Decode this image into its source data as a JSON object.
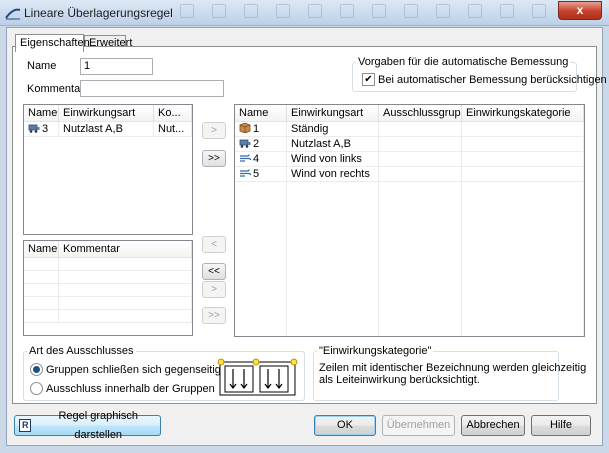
{
  "window": {
    "title": "Lineare Überlagerungsregel",
    "close_label": "x"
  },
  "tabs": [
    {
      "label": "Eigenschaften",
      "active": true
    },
    {
      "label": "Erweitert",
      "active": false
    }
  ],
  "form": {
    "name_label": "Name",
    "name_value": "1",
    "comment_label": "Kommentar",
    "comment_value": ""
  },
  "design_defaults": {
    "title": "Vorgaben für die automatische Bemessung",
    "checkbox_label": "Bei automatischer Bemessung berücksichtigen",
    "checked": true
  },
  "left_list": {
    "columns": [
      "Name",
      "Einwirkungsart",
      "Ko..."
    ],
    "rows": [
      {
        "name": "3",
        "type": "Nutzlast A,B",
        "ko": "Nut..."
      }
    ]
  },
  "group_list": {
    "columns": [
      "Name",
      "Kommentar"
    ]
  },
  "right_list": {
    "columns": [
      "Name",
      "Einwirkungsart",
      "Ausschlussgruppe",
      "Einwirkungskategorie"
    ],
    "rows": [
      {
        "name": "1",
        "type": "Ständig",
        "icon": "box-load-icon"
      },
      {
        "name": "2",
        "type": "Nutzlast A,B",
        "icon": "traffic-load-icon"
      },
      {
        "name": "4",
        "type": "Wind von links",
        "icon": "wind-load-icon"
      },
      {
        "name": "5",
        "type": "Wind von rechts",
        "icon": "wind-load-icon"
      }
    ]
  },
  "transfer_buttons": {
    "move_right": ">",
    "move_all_right": ">>",
    "move_left": "<",
    "move_all_left": "<<",
    "group_right": ">",
    "group_all_right": ">>"
  },
  "exclusion": {
    "title": "Art des Ausschlusses",
    "option1": "Gruppen schließen sich gegenseitig aus",
    "option2": "Ausschluss innerhalb der Gruppen",
    "selected": 1
  },
  "category_info": {
    "title": "\"Einwirkungskategorie\"",
    "text_line1": "Zeilen mit identischer Bezeichnung werden gleichzeitig",
    "text_line2": "als Leiteinwirkung berücksichtigt."
  },
  "footer": {
    "graphic_button": "Regel graphisch darstellen",
    "graphic_icon_letter": "R",
    "ok": "OK",
    "apply": "Übernehmen",
    "cancel": "Abbrechen",
    "help": "Hilfe"
  },
  "colors": {
    "accent": "#1c5180",
    "titlebar": "#bcd0e8",
    "close": "#c4402a"
  }
}
